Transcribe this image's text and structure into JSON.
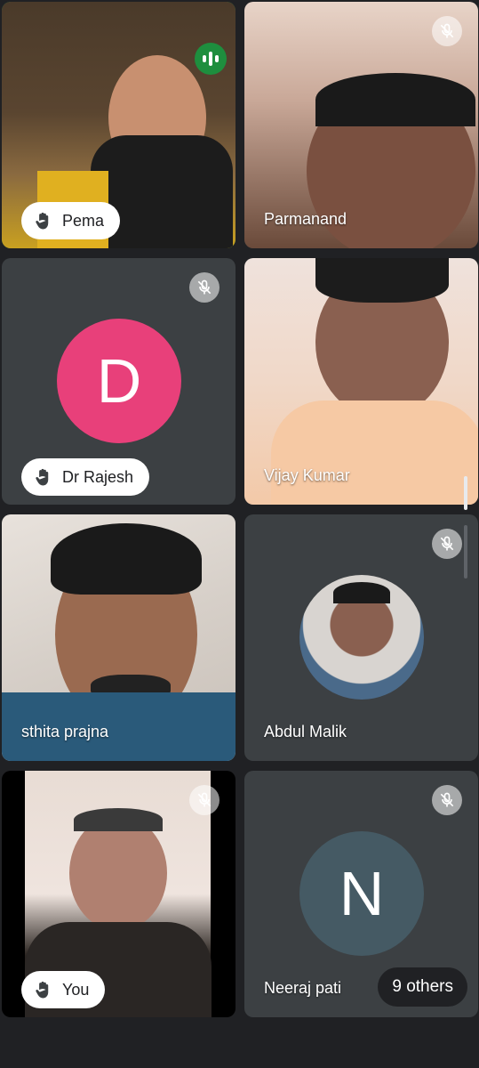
{
  "participants": [
    {
      "name": "Pema",
      "hand_raised": true,
      "speaking": true
    },
    {
      "name": "Parmanand",
      "muted": true
    },
    {
      "name": "Dr Rajesh",
      "hand_raised": true,
      "muted": true,
      "initial": "D",
      "avatar_color": "#e8407a"
    },
    {
      "name": "Vijay Kumar"
    },
    {
      "name": "sthita prajna"
    },
    {
      "name": "Abdul Malik",
      "muted": true
    },
    {
      "name": "You",
      "hand_raised": true,
      "muted": true
    },
    {
      "name": "Neeraj pati",
      "muted": true,
      "initial": "N",
      "avatar_color": "#455a64"
    }
  ],
  "others_label": "9 others",
  "colors": {
    "background": "#202124",
    "tile": "#3c4043",
    "speaking": "#1e8e3e"
  }
}
